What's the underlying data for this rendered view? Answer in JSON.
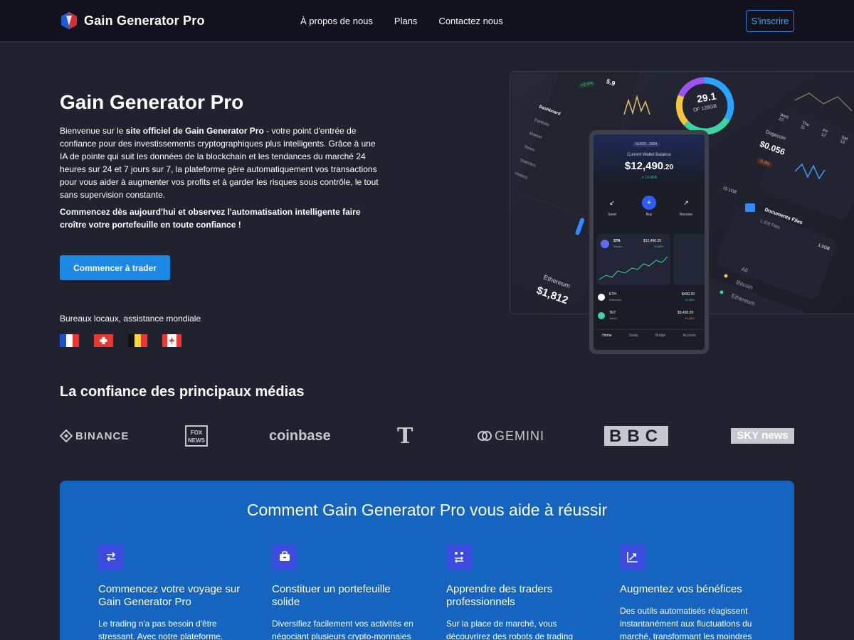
{
  "nav": {
    "brand": "Gain Generator Pro",
    "links": [
      "À propos de nous",
      "Plans",
      "Contactez nous"
    ],
    "signup": "S'inscrire"
  },
  "hero": {
    "title": "Gain Generator Pro",
    "intro_before": "Bienvenue sur le ",
    "intro_bold": "site officiel de Gain Generator Pro",
    "intro_after": " - votre point d'entrée de confiance pour des investissements cryptographiques plus intelligents. Grâce à une IA de pointe qui suit les données de la blockchain et les tendances du marché 24 heures sur 24 et 7 jours sur 7, la plateforme gère automatiquement vos transactions pour vous aider à augmenter vos profits et à garder les risques sous contrôle, le tout sans supervision constante.",
    "cta_text": "Commencez dès aujourd'hui et observez l'automatisation intelligente faire croître votre portefeuille en toute confiance !",
    "button": "Commencer à trader",
    "offices": "Bureaux locaux, assistance mondiale",
    "flags": [
      "france",
      "switzerland",
      "belgium",
      "canada"
    ]
  },
  "mockup": {
    "wallet_id": "0x2f20...3904",
    "balance_label": "Current Wallet Balance",
    "balance": "$12,490",
    "balance_cents": ".20",
    "change": "↗ 12.56%",
    "actions": [
      "Send",
      "Buy",
      "Receive"
    ],
    "card_symbol": "STA",
    "card_name": "Stacks",
    "card_value": "$12,490.20",
    "card_change": "+8.48%",
    "rows": [
      {
        "symbol": "ETH",
        "name": "Ethereum",
        "value": "$490.20",
        "change": "+6.48%"
      },
      {
        "symbol": "TET",
        "name": "Tether",
        "value": "$3,430.20",
        "change": "+6.48%"
      }
    ],
    "tabs": [
      "Home",
      "Swap",
      "Bridge",
      "Account"
    ],
    "donut_value": "29.1",
    "donut_sub": "OF 128GB",
    "dogecoin_label": "Dogecoin",
    "dogecoin_value": "$0.056",
    "dogecoin_change": "-0.3%",
    "storage": "15.1GB",
    "documents": "Documents Files",
    "documents_sub": "1,328 Files",
    "docs_size": "1.5GB",
    "eth_label": "Ethereum",
    "eth_value": "$1,812",
    "list_items": [
      "All",
      "Bitcoin",
      "Ethereum"
    ],
    "sidebar_items": [
      "Dashboard",
      "Portfolio",
      "Market",
      "News",
      "Statistics",
      "History"
    ],
    "days": [
      "Wed 10",
      "Thu 11",
      "Fri 12",
      "Sat 13"
    ],
    "badge": "+2.5%",
    "small_num": "5.9"
  },
  "media": {
    "title": "La confiance des principaux médias",
    "logos": [
      "BINANCE",
      "FOX NEWS",
      "coinbase",
      "T",
      "GEMINI",
      "BBC",
      "SKY news"
    ]
  },
  "features": {
    "title": "Comment Gain Generator Pro vous aide à réussir",
    "items": [
      {
        "icon": "exchange-arrows-icon",
        "title": "Commencez votre voyage sur Gain Generator Pro",
        "desc": "Le trading n'a pas besoin d'être stressant. Avec notre plateforme,"
      },
      {
        "icon": "briefcase-icon",
        "title": "Constituer un portefeuille solide",
        "desc": "Diversifiez facilement vos activités en négociant plusieurs crypto-monnaies"
      },
      {
        "icon": "transfer-icon",
        "title": "Apprendre des traders professionnels",
        "desc": "Sur la place de marché, vous découvrirez des robots de trading"
      },
      {
        "icon": "growth-chart-icon",
        "title": "Augmentez vos bénéfices",
        "desc": "Des outils automatisés réagissent instantanément aux fluctuations du marché, transformant les moindres"
      }
    ]
  },
  "colors": {
    "background": "#21222f",
    "nav": "#11121d",
    "accent": "#1e88e5",
    "features_bg": "#1565c0",
    "icon_bg": "#3b4bde"
  }
}
